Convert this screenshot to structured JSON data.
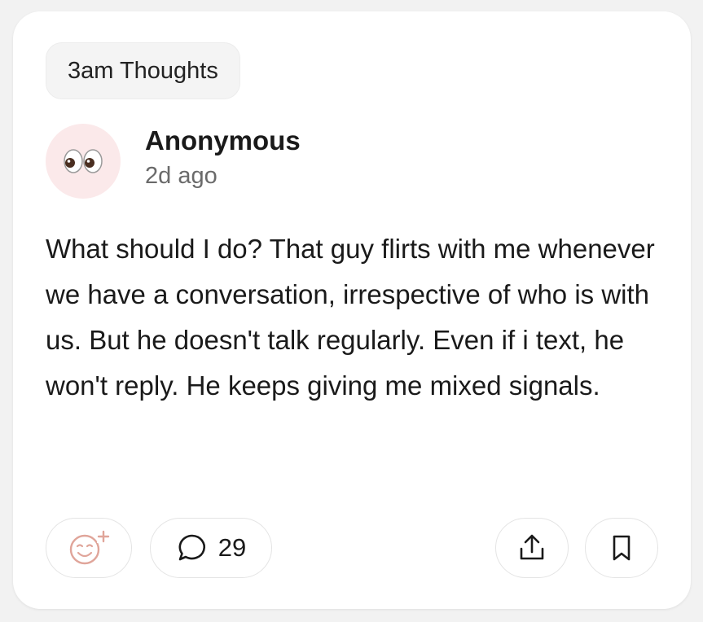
{
  "post": {
    "tag": "3am Thoughts",
    "author": "Anonymous",
    "time_ago": "2d ago",
    "avatar_icon": "eyes-icon",
    "body": "What should I do? That guy flirts with me whenever we have a conversation, irrespective of who is with us. But he doesn't talk regularly. Even if i text, he won't reply. He keeps giving me mixed signals."
  },
  "actions": {
    "react_icon": "add-reaction-icon",
    "comment_icon": "comment-icon",
    "comment_count": "29",
    "share_icon": "share-icon",
    "save_icon": "bookmark-icon"
  },
  "colors": {
    "avatar_bg": "#fbe9ea",
    "react_accent": "#e0a59a"
  }
}
